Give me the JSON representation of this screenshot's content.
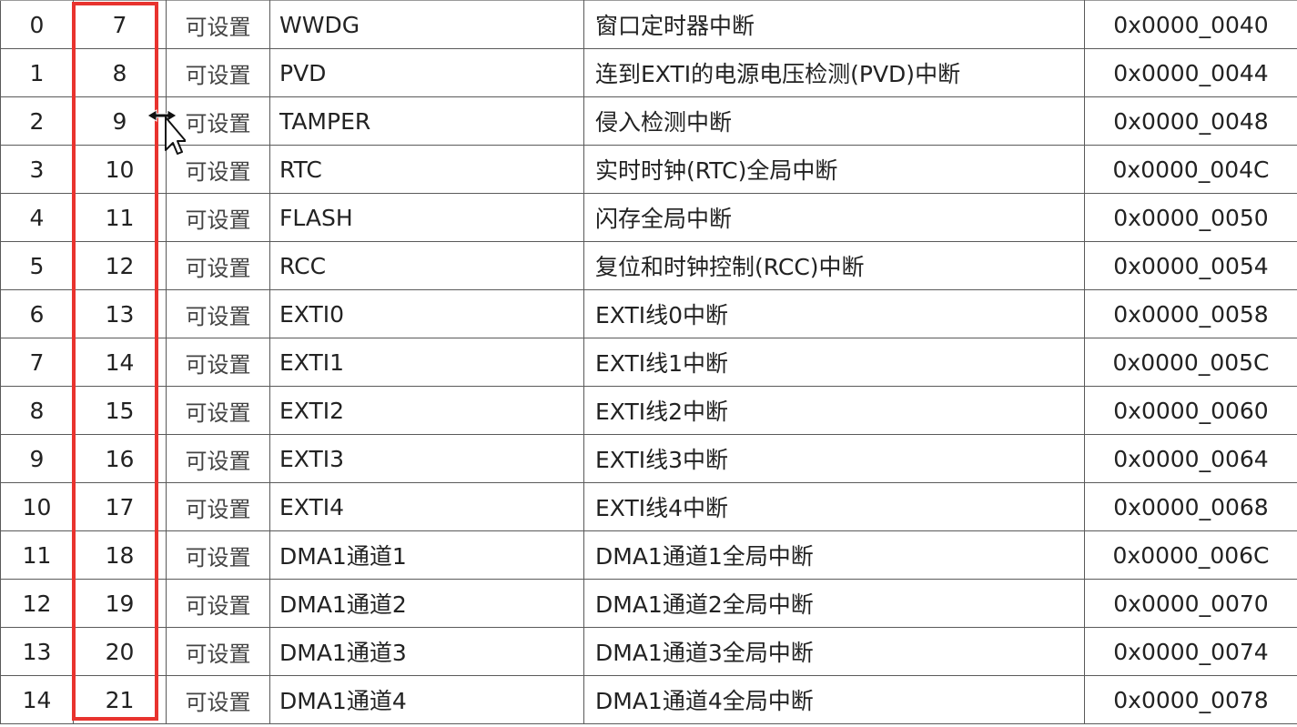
{
  "accent_color": "#e8332e",
  "rows": [
    {
      "position": "0",
      "priority": "7",
      "type": "可设置",
      "name": "WWDG",
      "description": "窗口定时器中断",
      "address": "0x0000_0040"
    },
    {
      "position": "1",
      "priority": "8",
      "type": "可设置",
      "name": "PVD",
      "description": "连到EXTI的电源电压检测(PVD)中断",
      "address": "0x0000_0044"
    },
    {
      "position": "2",
      "priority": "9",
      "type": "可设置",
      "name": "TAMPER",
      "description": "侵入检测中断",
      "address": "0x0000_0048"
    },
    {
      "position": "3",
      "priority": "10",
      "type": "可设置",
      "name": "RTC",
      "description": "实时时钟(RTC)全局中断",
      "address": "0x0000_004C"
    },
    {
      "position": "4",
      "priority": "11",
      "type": "可设置",
      "name": "FLASH",
      "description": "闪存全局中断",
      "address": "0x0000_0050"
    },
    {
      "position": "5",
      "priority": "12",
      "type": "可设置",
      "name": "RCC",
      "description": "复位和时钟控制(RCC)中断",
      "address": "0x0000_0054"
    },
    {
      "position": "6",
      "priority": "13",
      "type": "可设置",
      "name": "EXTI0",
      "description": "EXTI线0中断",
      "address": "0x0000_0058"
    },
    {
      "position": "7",
      "priority": "14",
      "type": "可设置",
      "name": "EXTI1",
      "description": "EXTI线1中断",
      "address": "0x0000_005C"
    },
    {
      "position": "8",
      "priority": "15",
      "type": "可设置",
      "name": "EXTI2",
      "description": "EXTI线2中断",
      "address": "0x0000_0060"
    },
    {
      "position": "9",
      "priority": "16",
      "type": "可设置",
      "name": "EXTI3",
      "description": "EXTI线3中断",
      "address": "0x0000_0064"
    },
    {
      "position": "10",
      "priority": "17",
      "type": "可设置",
      "name": "EXTI4",
      "description": "EXTI线4中断",
      "address": "0x0000_0068"
    },
    {
      "position": "11",
      "priority": "18",
      "type": "可设置",
      "name": "DMA1通道1",
      "description": "DMA1通道1全局中断",
      "address": "0x0000_006C"
    },
    {
      "position": "12",
      "priority": "19",
      "type": "可设置",
      "name": "DMA1通道2",
      "description": "DMA1通道2全局中断",
      "address": "0x0000_0070"
    },
    {
      "position": "13",
      "priority": "20",
      "type": "可设置",
      "name": "DMA1通道3",
      "description": "DMA1通道3全局中断",
      "address": "0x0000_0074"
    },
    {
      "position": "14",
      "priority": "21",
      "type": "可设置",
      "name": "DMA1通道4",
      "description": "DMA1通道4全局中断",
      "address": "0x0000_0078"
    }
  ]
}
